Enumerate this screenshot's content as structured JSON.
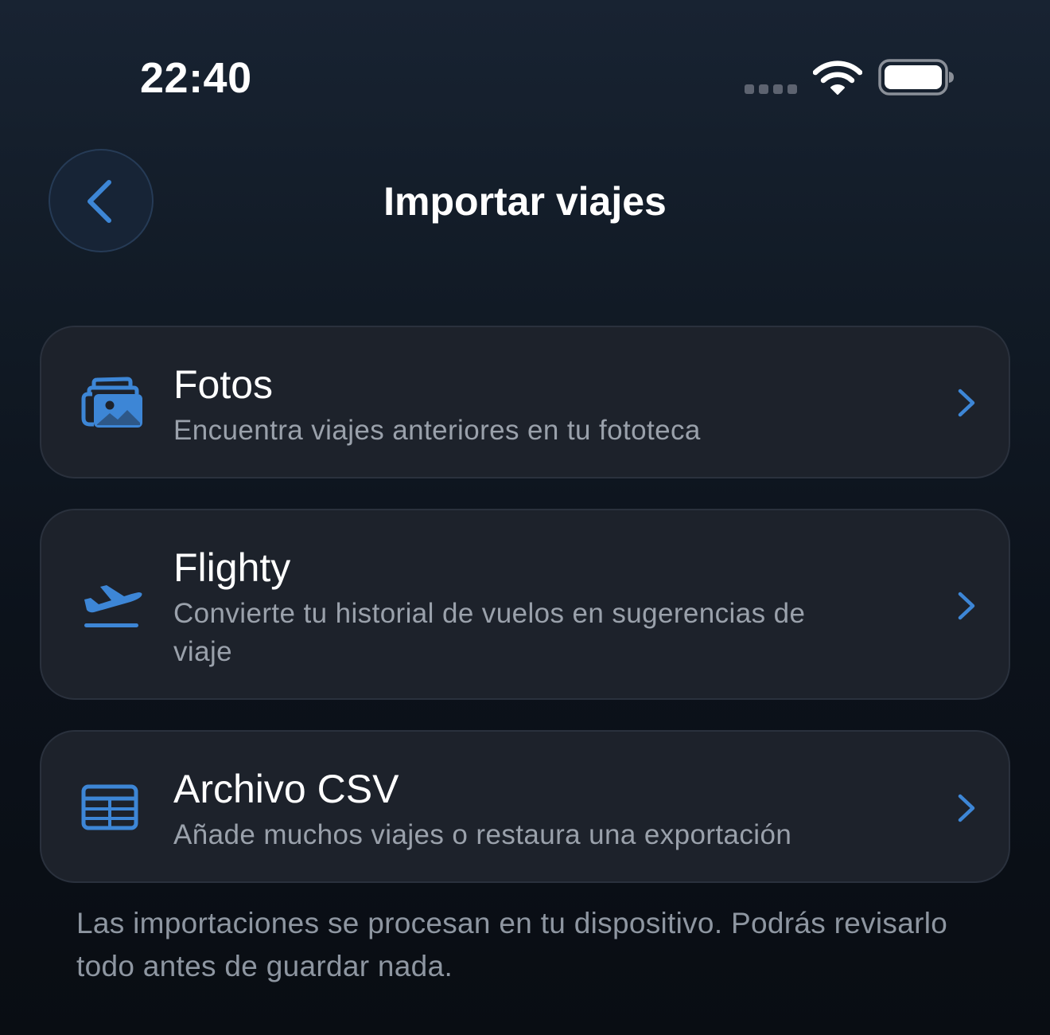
{
  "status_bar": {
    "time": "22:40",
    "icons": [
      "cellular-signal-icon",
      "wifi-icon",
      "battery-icon"
    ]
  },
  "header": {
    "title": "Importar viajes",
    "back_icon": "chevron-left-icon"
  },
  "options": [
    {
      "icon": "photos-icon",
      "title": "Fotos",
      "subtitle": "Encuentra viajes anteriores en tu fototeca"
    },
    {
      "icon": "airplane-takeoff-icon",
      "title": "Flighty",
      "subtitle": "Convierte tu historial de vuelos en sugerencias de viaje"
    },
    {
      "icon": "table-icon",
      "title": "Archivo CSV",
      "subtitle": "Añade muchos viajes o restaura una exportación"
    }
  ],
  "footer": {
    "note": "Las importaciones se procesan en tu dispositivo. Podrás revisarlo todo antes de guardar nada."
  },
  "colors": {
    "accent": "#3d86d6",
    "background": "#0f1620",
    "card": "#1d222b",
    "secondary_text": "#9aa1ab"
  }
}
